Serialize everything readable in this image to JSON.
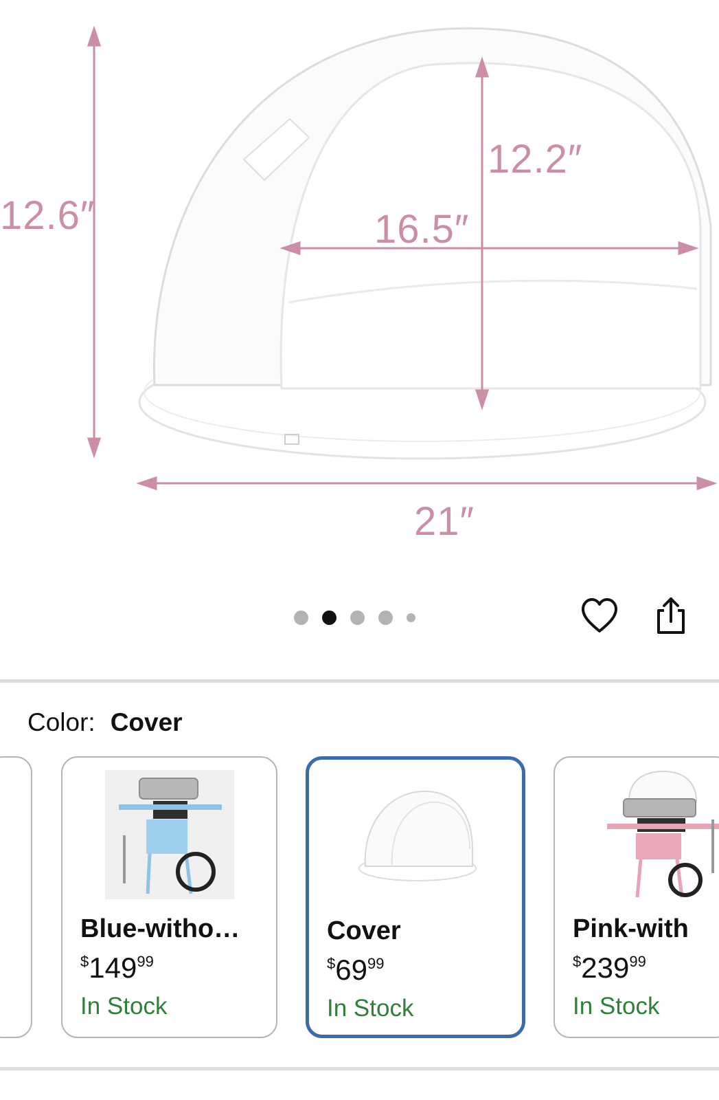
{
  "image": {
    "dimensions": {
      "height": "12.6″",
      "back_height": "12.2″",
      "opening_width": "16.5″",
      "diameter": "21″"
    },
    "dim_color": "#cc8ea6"
  },
  "carousel": {
    "dot_count": 5,
    "active_index": 1
  },
  "actions": {
    "favorite_icon": "heart-icon",
    "share_icon": "share-icon"
  },
  "color_selector": {
    "label": "Color:",
    "selected_value": "Cover",
    "options": [
      {
        "name": "Blue-witho…",
        "price_symbol": "$",
        "price_whole": "149",
        "price_cents": "99",
        "stock": "In Stock"
      },
      {
        "name": "Cover",
        "price_symbol": "$",
        "price_whole": "69",
        "price_cents": "99",
        "stock": "In Stock",
        "selected": true
      },
      {
        "name": "Pink-with",
        "price_symbol": "$",
        "price_whole": "239",
        "price_cents": "99",
        "stock": "In Stock"
      }
    ],
    "selected_border_color": "#3d6aa8",
    "stock_color": "#2f7f3b"
  }
}
